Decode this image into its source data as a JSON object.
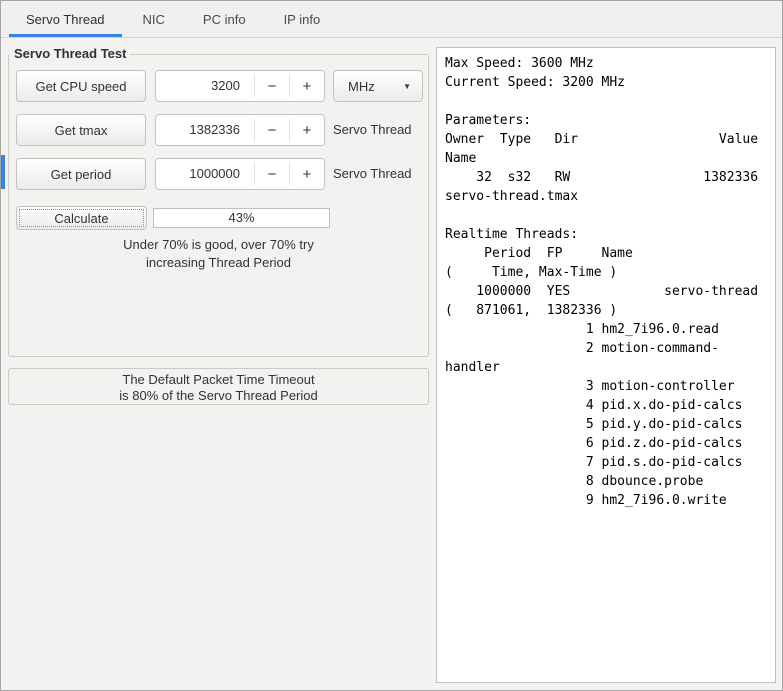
{
  "colors": {
    "accent": "#3584e4"
  },
  "tabs": [
    {
      "label": "Servo Thread"
    },
    {
      "label": "NIC"
    },
    {
      "label": "PC info"
    },
    {
      "label": "IP info"
    }
  ],
  "servo_test": {
    "frame_title": "Servo Thread Test",
    "rows": [
      {
        "button": "Get CPU speed",
        "value": "3200",
        "unit": "MHz"
      },
      {
        "button": "Get tmax",
        "value": "1382336",
        "label": "Servo Thread"
      },
      {
        "button": "Get period",
        "value": "1000000",
        "label": "Servo Thread"
      }
    ],
    "calculate_button": "Calculate",
    "result": "43%",
    "hint_line1": "Under 70% is good, over 70% try",
    "hint_line2": "increasing Thread Period"
  },
  "timeout_note": {
    "line1": "The Default Packet Time Timeout",
    "line2": "is 80% of the Servo Thread Period"
  },
  "output_lines": [
    "Max Speed: 3600 MHz",
    "Current Speed: 3200 MHz",
    "",
    "Parameters:",
    "Owner  Type   Dir                  Value",
    "Name",
    "    32  s32   RW                 1382336",
    "servo-thread.tmax",
    "",
    "Realtime Threads:",
    "     Period  FP     Name",
    "(     Time, Max-Time )",
    "    1000000  YES            servo-thread",
    "(   871061,  1382336 )",
    "                  1 hm2_7i96.0.read",
    "                  2 motion-command-",
    "handler",
    "                  3 motion-controller",
    "                  4 pid.x.do-pid-calcs",
    "                  5 pid.y.do-pid-calcs",
    "                  6 pid.z.do-pid-calcs",
    "                  7 pid.s.do-pid-calcs",
    "                  8 dbounce.probe",
    "                  9 hm2_7i96.0.write"
  ],
  "icons": {
    "minus": "−",
    "plus": "+",
    "dropdown_arrow": "▼"
  }
}
